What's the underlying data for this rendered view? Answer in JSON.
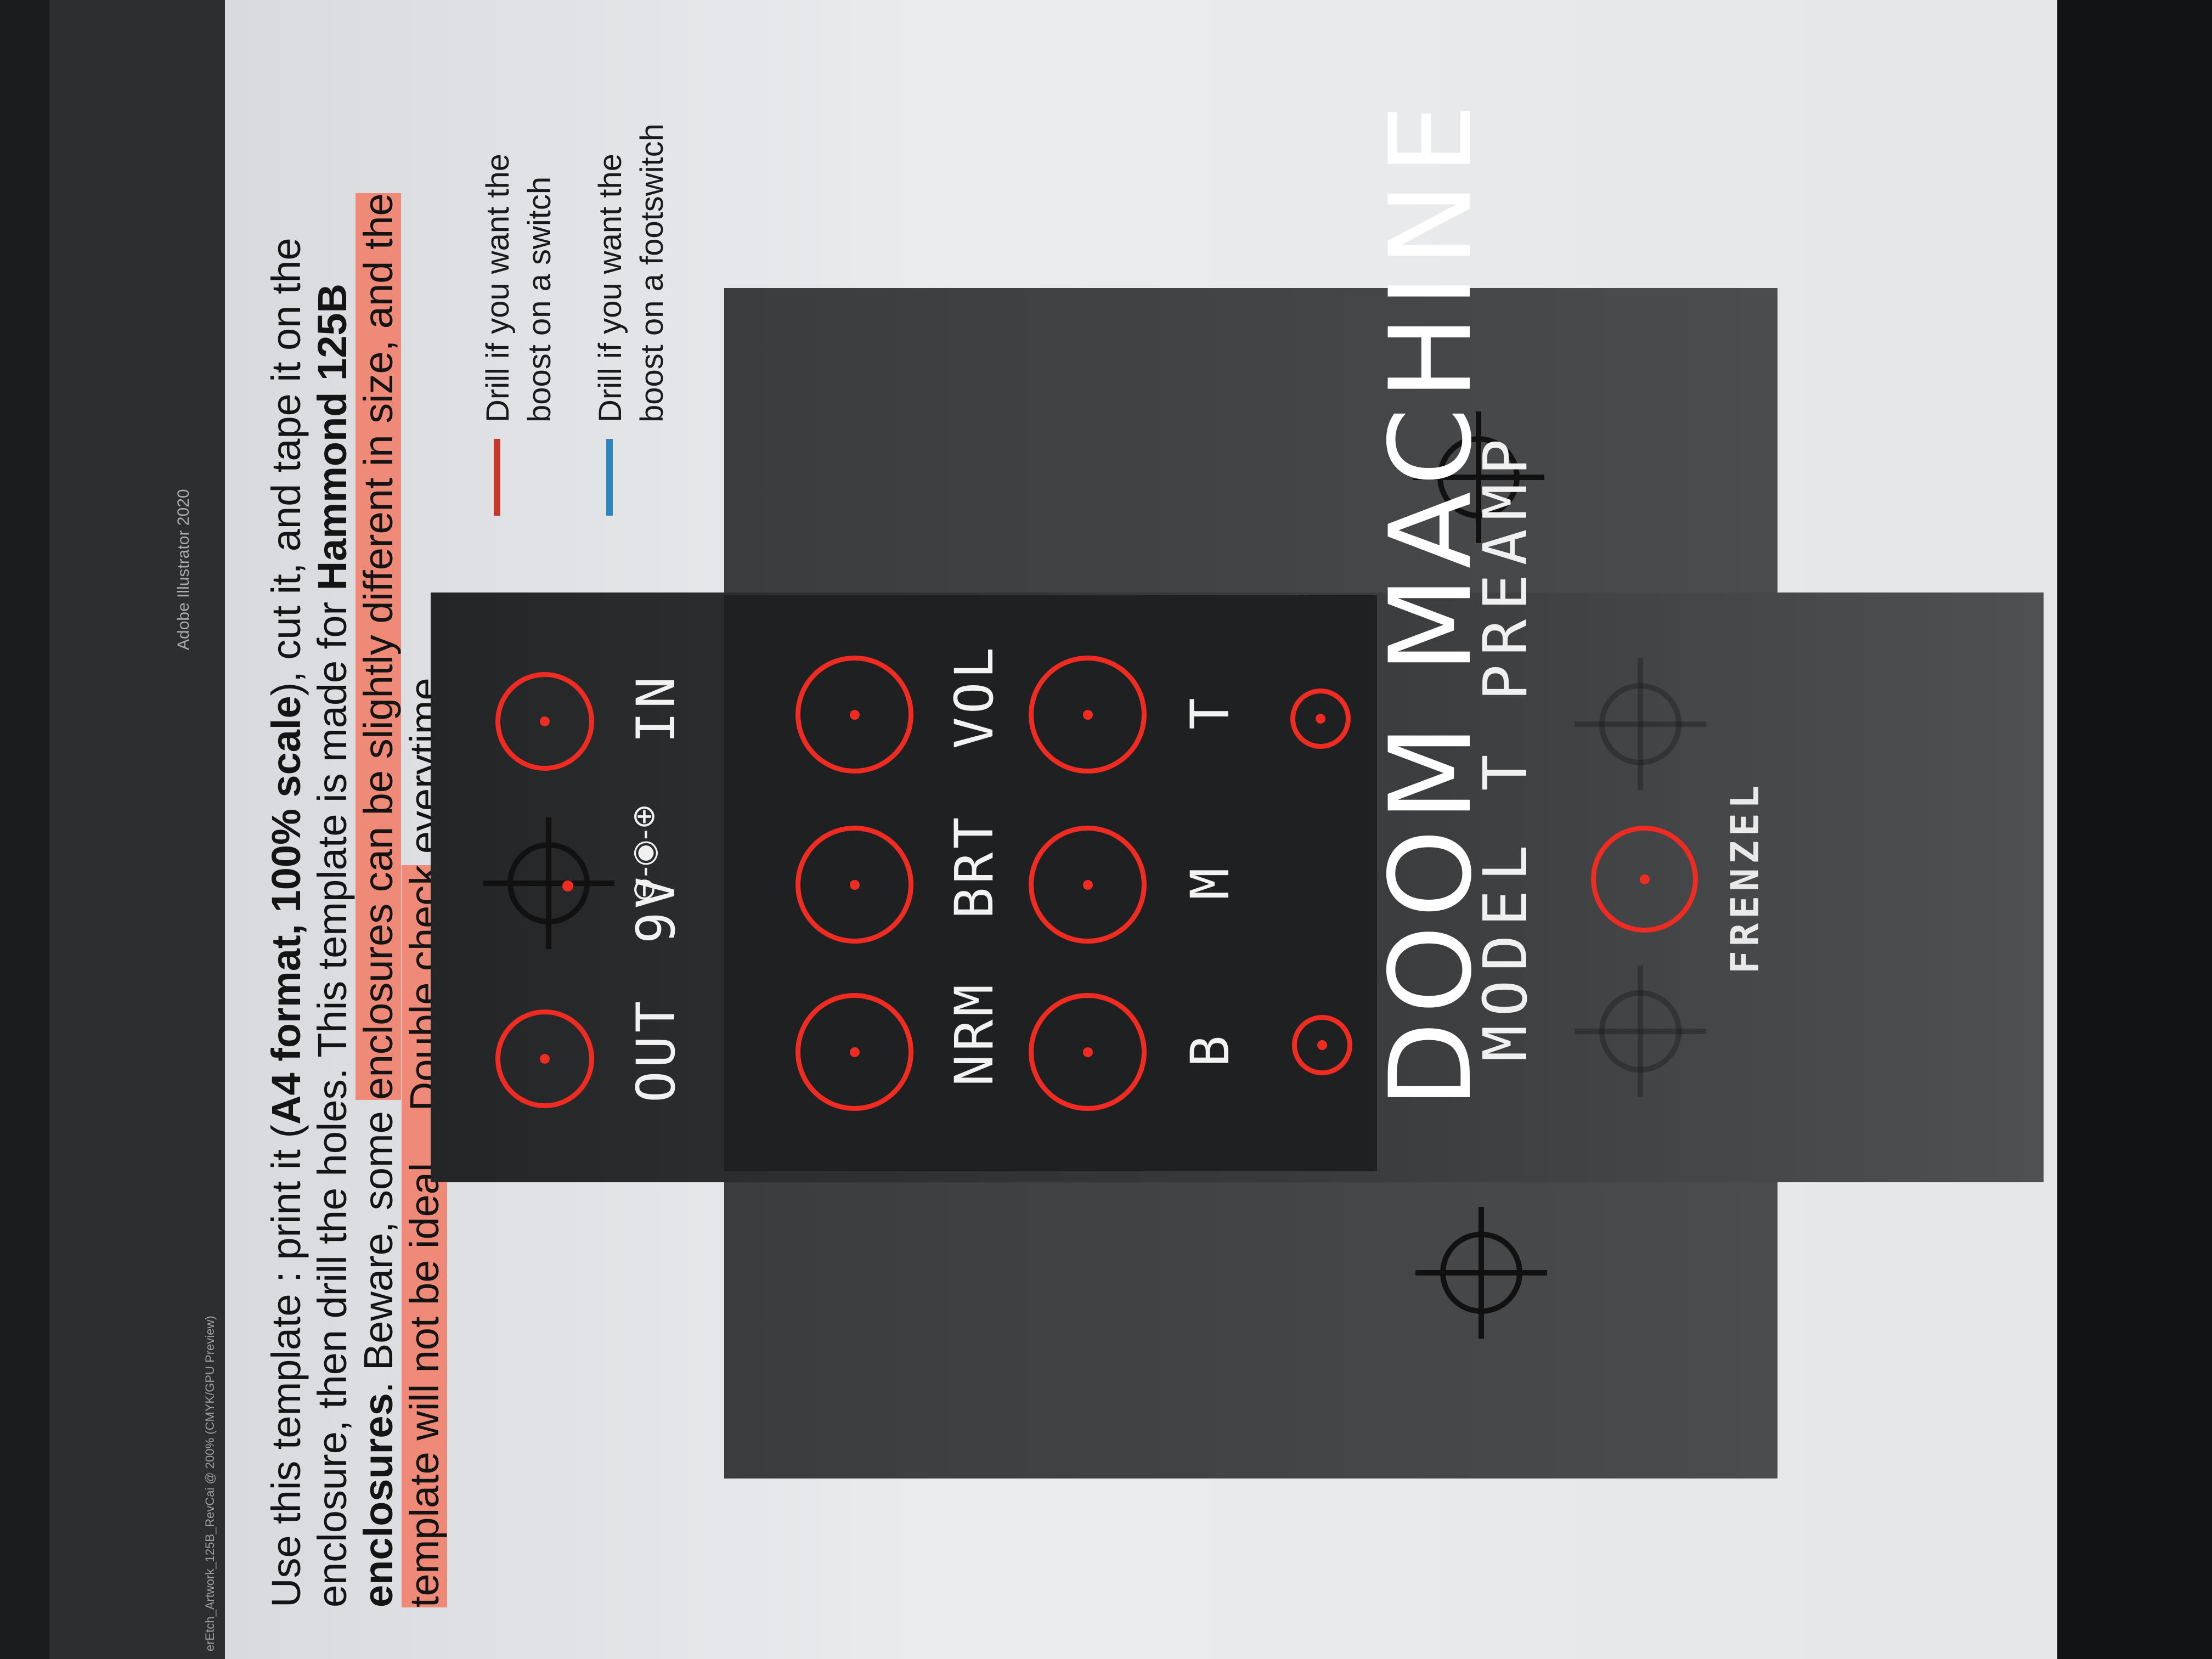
{
  "window": {
    "doc_title": "erEtch_Artwork_125B_RevCai @ 200% (CMYK/GPU Preview)",
    "app_title": "Adobe Illustrator 2020"
  },
  "instructions": {
    "p1": "Use this template : print it (",
    "b1": "A4 format, 100% scale",
    "p2": "), cut it, and tape it on the enclosure, then drill the holes. This template is made for ",
    "b2": "Hammond 125B enclosures",
    "p3": ". Beware, some ",
    "highlight": "enclosures can be slightly different in size, and the template will not be ideal… Double check",
    "p4": " everytime."
  },
  "legend": {
    "red_text": "Drill if you want the boost on a switch",
    "blue_text": "Drill if you want the boost on a footswitch",
    "red_color": "#c0392b",
    "blue_color": "#2e86c1"
  },
  "panel": {
    "jacks": {
      "out": "OUT",
      "dc": "9V",
      "in": "IN"
    },
    "knobs": {
      "nrm": "NRM",
      "brt": "BRT",
      "vol": "VOL",
      "b": "B",
      "m": "M",
      "t": "T"
    },
    "title": "DOOM MACHINE",
    "subtitle": "MODEL T PREAMP",
    "maker": "FRENZEL",
    "dc_icon": "⊖-◉-⊕",
    "hole_color": "#ef2b22"
  }
}
